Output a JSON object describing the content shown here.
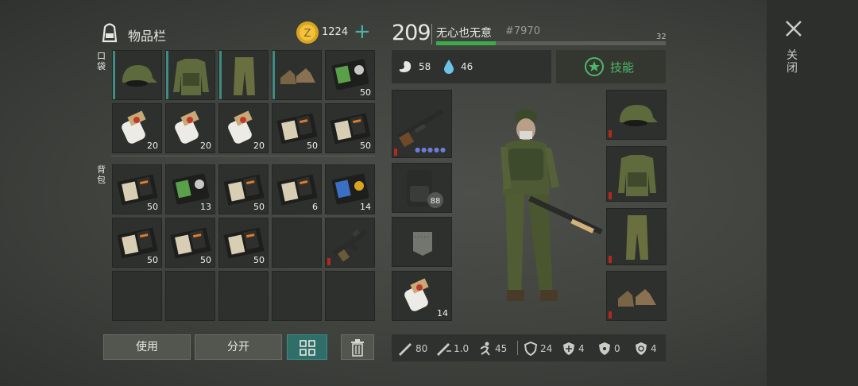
{
  "inventory": {
    "title": "物品栏",
    "coins": "1224",
    "pocket_label": "口袋",
    "backpack_label": "背包",
    "pocket_counts": [
      "",
      "",
      "",
      "",
      "50",
      "20",
      "20",
      "20",
      "50",
      "50"
    ],
    "backpack_counts": [
      "50",
      "13",
      "50",
      "6",
      "14",
      "50",
      "50",
      "50",
      "",
      ""
    ]
  },
  "buttons": {
    "use": "使用",
    "split": "分开"
  },
  "character": {
    "level": "209",
    "name": "无心也无意",
    "id": "#7970",
    "xp_max": "32",
    "xp_fill": 0.26,
    "hunger": "58",
    "thirst": "46",
    "skills": "技能",
    "hand_item_count": "14"
  },
  "stats": {
    "damage": "80",
    "speed": "1.0",
    "run": "45",
    "defense": "24",
    "cold": "4",
    "radiation": "0",
    "toxic": "4"
  },
  "close": "关闭",
  "colors": {
    "teal": "#3f8b86",
    "xp_green": "#3dab4a",
    "red_marker": "#b3281f",
    "coin": "#d9a520"
  }
}
